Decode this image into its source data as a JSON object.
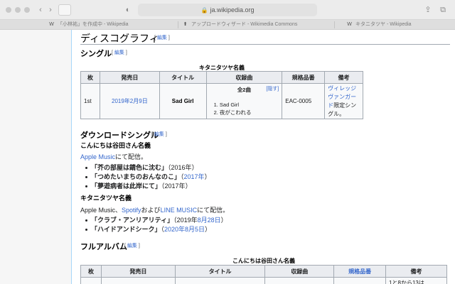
{
  "browser": {
    "url": "ja.wikipedia.org",
    "tabs": [
      {
        "favicon": "W",
        "title": "「小林祐」を作成中 - Wikipedia"
      },
      {
        "favicon": "⬆",
        "title": "アップロードウィザード - Wikimedia Commons"
      },
      {
        "favicon": "W",
        "title": "キタニタツヤ - Wikipedia"
      }
    ]
  },
  "page": {
    "section_title": "ディスコグラフィ",
    "edit_label": "編集",
    "singles": {
      "heading": "シングル",
      "caption": "キタニタツヤ名義",
      "headers": [
        "枚",
        "発売日",
        "タイトル",
        "収録曲",
        "規格品番",
        "備考"
      ],
      "row": {
        "num": "1st",
        "date": "2019年2月9日",
        "title": "Sad Girl",
        "tracks_heading": "全2曲",
        "hide_label": "[隠す]",
        "tracks": [
          "1.  Sad Girl",
          "2.  夜がこわれる"
        ],
        "catalog": "EAC-0005",
        "note_link": "ヴィレッジヴァンガード",
        "note_rest": "限定シングル。"
      }
    },
    "download_singles": {
      "heading": "ダウンロードシングル",
      "group1": {
        "heading": "こんにちは谷田さん名義",
        "intro_link": "Apple Music",
        "intro_rest": "にて配信。",
        "items": [
          {
            "title": "「芥の部屋は錆色に沈む」",
            "year_prefix": "（",
            "year": "2016年",
            "year_suffix": "）",
            "year_is_link": false
          },
          {
            "title": "「つめたいまちのおんなのこ」",
            "year_prefix": "（",
            "year": "2017年",
            "year_suffix": "）",
            "year_is_link": true
          },
          {
            "title": "「夢遊病者は此岸にて」",
            "year_prefix": "（",
            "year": "2017年",
            "year_suffix": "）",
            "year_is_link": false
          }
        ]
      },
      "group2": {
        "heading": "キタニタツヤ名義",
        "intro_a": "Apple Music、",
        "intro_link1": "Spotify",
        "intro_b": "および",
        "intro_link2": "LINE MUSIC",
        "intro_c": "にて配信。",
        "items": [
          {
            "title": "「クラブ・アンリアリティ」",
            "prefix": "（2019年",
            "link": "8月28日",
            "suffix": "）"
          },
          {
            "title": "「ハイドアンドシーク」",
            "prefix": "（",
            "link": "2020年8月5日",
            "suffix": "）"
          }
        ]
      }
    },
    "full_albums": {
      "heading": "フルアルバム",
      "caption": "こんにちは谷田さん名義",
      "headers": [
        "枚",
        "発売日",
        "タイトル",
        "収録曲",
        "規格品番",
        "備考"
      ],
      "partial_note": "1と8から13は"
    }
  }
}
